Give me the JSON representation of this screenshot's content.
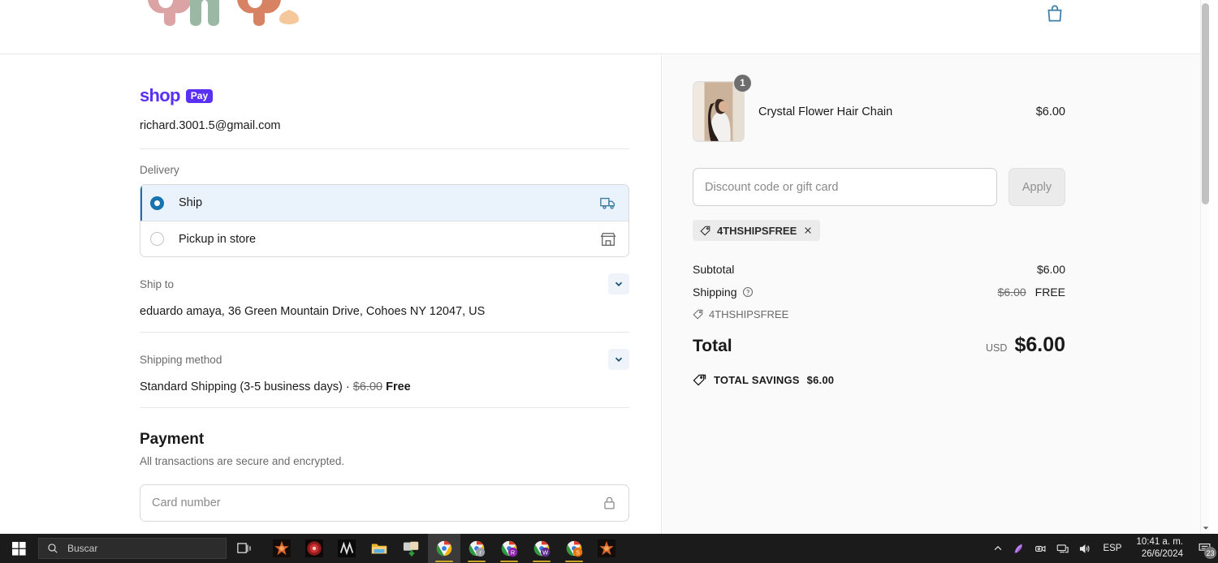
{
  "site_header": {
    "logo_text": "andi",
    "logo_colors": [
      "#dba3a3",
      "#9bb8a4",
      "#d78263",
      "#f4c89a"
    ],
    "cart_icon": "shopping-bag-icon",
    "cart_icon_color": "#3d7ea6"
  },
  "checkout": {
    "wallet": {
      "name": "shop",
      "badge": "Pay",
      "color": "#5a31f4"
    },
    "email": "richard.3001.5@gmail.com",
    "delivery": {
      "label": "Delivery",
      "options": [
        {
          "label": "Ship",
          "icon": "delivery-truck-icon",
          "selected": true
        },
        {
          "label": "Pickup in store",
          "icon": "storefront-icon",
          "selected": false
        }
      ]
    },
    "ship_to": {
      "label": "Ship to",
      "value": "eduardo amaya, 36 Green Mountain Drive, Cohoes NY 12047, US",
      "chevron_icon": "chevron-down-icon"
    },
    "shipping_method": {
      "label": "Shipping method",
      "name": "Standard Shipping (3-5 business days)",
      "separator": "·",
      "original_price": "$6.00",
      "final_price": "Free",
      "chevron_icon": "chevron-down-icon"
    },
    "payment": {
      "title": "Payment",
      "subtitle": "All transactions are secure and encrypted.",
      "card_placeholder": "Card number",
      "lock_icon": "lock-icon"
    }
  },
  "summary": {
    "items": [
      {
        "name": "Crystal Flower Hair Chain",
        "price": "$6.00",
        "quantity": "1",
        "image_alt": "woman-wearing-hair-chain"
      }
    ],
    "discount": {
      "placeholder": "Discount code or gift card",
      "apply_label": "Apply",
      "applied_code": "4THSHIPSFREE",
      "remove_icon": "close-icon",
      "tag_icon": "tag-icon"
    },
    "totals": {
      "subtotal_label": "Subtotal",
      "subtotal_value": "$6.00",
      "shipping_label": "Shipping",
      "shipping_info_icon": "question-circle-icon",
      "shipping_original": "$6.00",
      "shipping_value": "FREE",
      "shipping_code": "4THSHIPSFREE",
      "total_label": "Total",
      "currency": "USD",
      "total_value": "$6.00",
      "savings_label": "TOTAL SAVINGS",
      "savings_value": "$6.00",
      "savings_icon": "double-tag-icon"
    }
  },
  "taskbar": {
    "start_icon": "windows-start-icon",
    "search_placeholder": "Buscar",
    "search_icon": "search-icon",
    "taskview_icon": "task-view-icon",
    "apps": [
      {
        "name": "app-wineskin-orange",
        "type": "star-orange",
        "running": false,
        "active": false
      },
      {
        "name": "app-red-disc",
        "type": "disc-red",
        "running": false,
        "active": false
      },
      {
        "name": "app-dark-tile",
        "type": "tile-dark",
        "running": false,
        "active": false
      },
      {
        "name": "app-file-explorer",
        "type": "folder",
        "running": false,
        "active": false
      },
      {
        "name": "app-download-manager",
        "type": "download",
        "running": false,
        "active": false
      },
      {
        "name": "app-chrome",
        "type": "chrome",
        "badge": "",
        "running": true,
        "active": true
      },
      {
        "name": "app-chrome-profile-r",
        "type": "chrome",
        "badge": "r",
        "badge_color": "#9aa0a6",
        "running": true,
        "active": false
      },
      {
        "name": "app-chrome-profile-R",
        "type": "chrome",
        "badge": "R",
        "badge_color": "#8e24aa",
        "running": true,
        "active": false
      },
      {
        "name": "app-chrome-profile-W",
        "type": "chrome",
        "badge": "W",
        "badge_color": "#5b2d8e",
        "running": true,
        "active": false
      },
      {
        "name": "app-chrome-profile-S",
        "type": "chrome",
        "badge": "S",
        "badge_color": "#e8710a",
        "running": true,
        "active": false
      },
      {
        "name": "app-wineskin-orange-2",
        "type": "star-orange",
        "running": false,
        "active": false
      }
    ],
    "tray": {
      "chevron_icon": "chevron-up-icon",
      "feather_icon": "feather-icon",
      "camera_icon": "camera-icon",
      "network_icon": "network-icon",
      "volume_icon": "volume-icon",
      "language": "ESP",
      "time": "10:41 a. m.",
      "date": "26/6/2024",
      "notification_icon": "notification-icon",
      "notification_count": "23"
    }
  }
}
